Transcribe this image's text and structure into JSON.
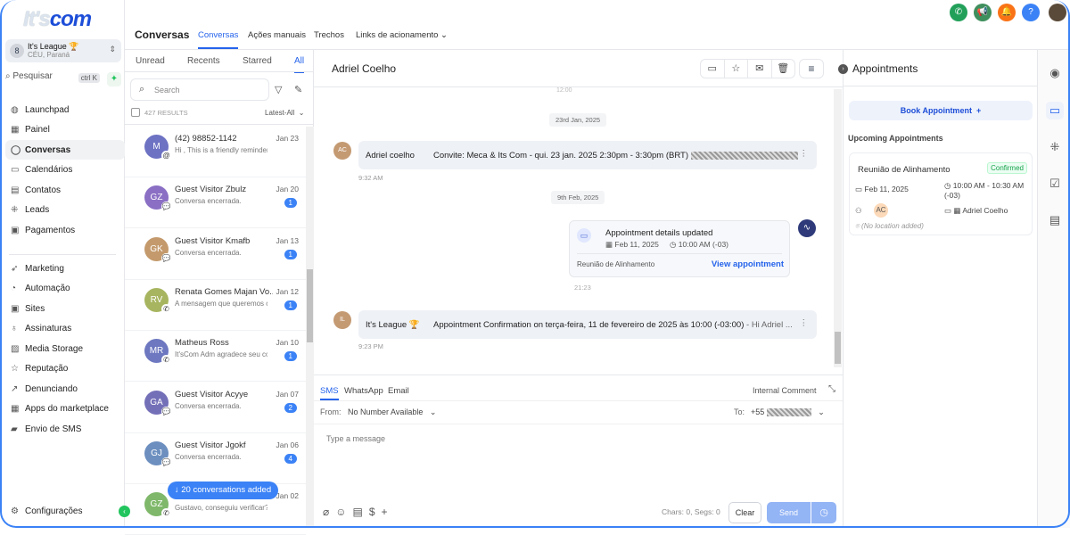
{
  "brand": {
    "logo_text": "It'sCom"
  },
  "account": {
    "name": "It's League 🏆",
    "location": "CÉU, Paraná",
    "avatar": "8"
  },
  "quick_search": {
    "label": "Pesquisar",
    "shortcut": "ctrl K"
  },
  "sidebar": {
    "items": [
      {
        "label": "Launchpad",
        "icon": "◍"
      },
      {
        "label": "Painel",
        "icon": "▦"
      },
      {
        "label": "Conversas",
        "icon": "◯"
      },
      {
        "label": "Calendários",
        "icon": "▭"
      },
      {
        "label": "Contatos",
        "icon": "▤"
      },
      {
        "label": "Leads",
        "icon": "⁜"
      },
      {
        "label": "Pagamentos",
        "icon": "▣"
      }
    ],
    "items2": [
      {
        "label": "Marketing",
        "icon": "➶"
      },
      {
        "label": "Automação",
        "icon": "◔"
      },
      {
        "label": "Sites",
        "icon": "▣"
      },
      {
        "label": "Assinaturas",
        "icon": "♁"
      },
      {
        "label": "Media Storage",
        "icon": "▨"
      },
      {
        "label": "Reputação",
        "icon": "☆"
      },
      {
        "label": "Denunciando",
        "icon": "↗"
      },
      {
        "label": "Apps do marketplace",
        "icon": "▦"
      },
      {
        "label": "Envio de SMS",
        "icon": "▰"
      }
    ],
    "settings": "Configurações"
  },
  "header": {
    "title": "Conversas",
    "tabs": [
      "Conversas",
      "Ações manuais",
      "Trechos",
      "Links de acionamento ⌄"
    ]
  },
  "top_icons": [
    {
      "name": "phone",
      "glyph": "✆",
      "color": "#22a05a"
    },
    {
      "name": "megaphone",
      "glyph": "📢",
      "color": "#3f8f5d"
    },
    {
      "name": "bell",
      "glyph": "🔔",
      "color": "#f97316"
    },
    {
      "name": "help",
      "glyph": "?",
      "color": "#3b82f6"
    }
  ],
  "list": {
    "tabs": [
      "Unread",
      "Recents",
      "Starred",
      "All"
    ],
    "search_placeholder": "Search",
    "results": "427 RESULTS",
    "sort": "Latest-All",
    "items": [
      {
        "initials": "M",
        "color": "#6d72c3",
        "channel": "@",
        "name": "(42) 98852-1142",
        "preview": "Hi , This is a friendly reminder al",
        "date": "Jan 23",
        "badge": ""
      },
      {
        "initials": "GZ",
        "color": "#8a6fc4",
        "channel": "💬",
        "name": "Guest Visitor Zbulz",
        "preview": "Conversa encerrada.",
        "date": "Jan 20",
        "badge": "1"
      },
      {
        "initials": "GK",
        "color": "#c49a6c",
        "channel": "💬",
        "name": "Guest Visitor Kmafb",
        "preview": "Conversa encerrada.",
        "date": "Jan 13",
        "badge": "1"
      },
      {
        "initials": "RV",
        "color": "#a8b560",
        "channel": "✆",
        "name": "Renata Gomes Majan Vo...",
        "preview": "A mensagem que queremos com",
        "date": "Jan 12",
        "badge": "1"
      },
      {
        "initials": "MR",
        "color": "#6d78c0",
        "channel": "✆",
        "name": "Matheus Ross",
        "preview": "It'sCom Adm agradece seu conta",
        "date": "Jan 10",
        "badge": "1"
      },
      {
        "initials": "GA",
        "color": "#7470b8",
        "channel": "💬",
        "name": "Guest Visitor Acyye",
        "preview": "Conversa encerrada.",
        "date": "Jan 07",
        "badge": "2"
      },
      {
        "initials": "GJ",
        "color": "#6c8fbf",
        "channel": "💬",
        "name": "Guest Visitor Jgokf",
        "preview": "Conversa encerrada.",
        "date": "Jan 06",
        "badge": "4"
      },
      {
        "initials": "GZ",
        "color": "#7fb86a",
        "channel": "✆",
        "name": "",
        "preview": "Gustavo, conseguiu verificar?",
        "date": "Jan 02",
        "badge": ""
      }
    ],
    "toast": "↓ 20 conversations added"
  },
  "chat": {
    "contact": "Adriel Coelho",
    "top_time": "12:00",
    "date1": "23rd Jan, 2025",
    "msg1": {
      "avatar": "AC",
      "from": "Adriel coelho",
      "body": "Convite: Meca & Its Com - qui. 23 jan. 2025 2:30pm - 3:30pm (BRT)",
      "time": "9:32 AM"
    },
    "date2": "9th Feb, 2025",
    "appt": {
      "title": "Appointment details updated",
      "date": "Feb 11, 2025",
      "time": "10:00 AM (-03)",
      "name": "Reunião de Alinhamento",
      "link": "View appointment",
      "timestamp": "21:23"
    },
    "msg2": {
      "avatar": "IL",
      "from": "It's League 🏆",
      "body": "Appointment Confirmation on terça-feira, 11 de fevereiro de 2025 às 10:00 (-03:00)",
      "tail": "-  Hi Adriel ...",
      "time": "9:23 PM"
    }
  },
  "composer": {
    "tabs": [
      "SMS",
      "WhatsApp",
      "Email"
    ],
    "internal": "Internal Comment",
    "from_label": "From:",
    "from_value": "No Number Available",
    "to_label": "To:",
    "to_value": "+55",
    "placeholder": "Type a message",
    "counter": "Chars: 0, Segs: 0",
    "clear": "Clear",
    "send": "Send"
  },
  "appointments": {
    "title": "Appointments",
    "book": "Book Appointment",
    "upcoming": "Upcoming Appointments",
    "card": {
      "title": "Reunião de Alinhamento",
      "status": "Confirmed",
      "date": "Feb 11, 2025",
      "time": "10:00 AM - 10:30 AM (-03)",
      "attendee": "AC",
      "calendar": "Adriel Coelho",
      "location": "(No location added)"
    }
  }
}
